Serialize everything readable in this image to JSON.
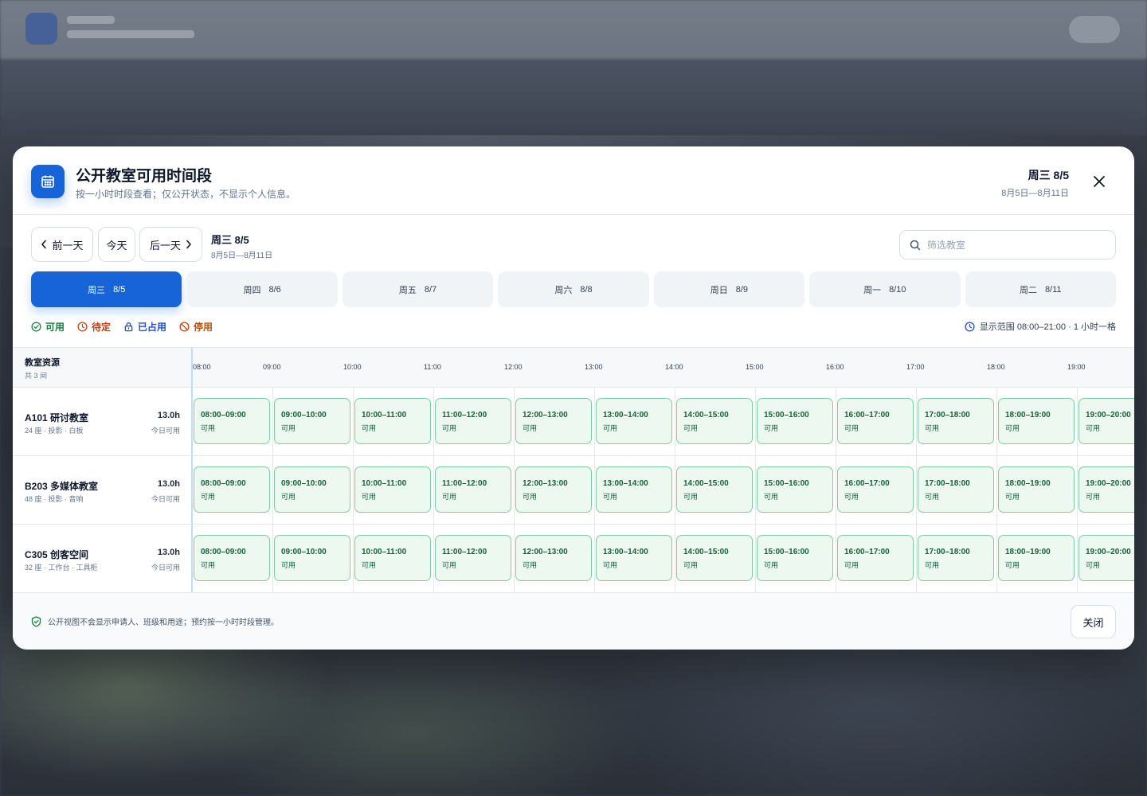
{
  "modal": {
    "title": "公开教室可用时间段",
    "subtitle": "按一小时时段查看；仅公开状态，不显示个人信息。",
    "current_day": "周三 8/5",
    "date_range": "8月5日—8月11日"
  },
  "toolbar": {
    "prev_label": "前一天",
    "today_label": "今天",
    "next_label": "后一天",
    "current_day": "周三 8/5",
    "date_range": "8月5日—8月11日",
    "search_placeholder": "筛选教室",
    "search_value": ""
  },
  "day_tabs": [
    {
      "weekday": "周三",
      "date": "8/5",
      "active": true
    },
    {
      "weekday": "周四",
      "date": "8/6",
      "active": false
    },
    {
      "weekday": "周五",
      "date": "8/7",
      "active": false
    },
    {
      "weekday": "周六",
      "date": "8/8",
      "active": false
    },
    {
      "weekday": "周日",
      "date": "8/9",
      "active": false
    },
    {
      "weekday": "周一",
      "date": "8/10",
      "active": false
    },
    {
      "weekday": "周二",
      "date": "8/11",
      "active": false
    }
  ],
  "legend": {
    "available": "可用",
    "pending": "待定",
    "occupied": "已占用",
    "disabled": "停用",
    "range_note": "显示范围 08:00–21:00 · 1 小时一格"
  },
  "grid": {
    "resource_header": "教室资源",
    "resource_count": "共 3 间",
    "hours": [
      "08:00",
      "09:00",
      "10:00",
      "11:00",
      "12:00",
      "13:00",
      "14:00",
      "15:00",
      "16:00",
      "17:00",
      "18:00",
      "19:00"
    ],
    "rooms": [
      {
        "name": "A101 研讨教室",
        "meta": "24 座 · 投影 · 白板",
        "hours": "13.0h",
        "hours_label": "今日可用",
        "slots": [
          {
            "time": "08:00–09:00",
            "status": "可用"
          },
          {
            "time": "09:00–10:00",
            "status": "可用"
          },
          {
            "time": "10:00–11:00",
            "status": "可用"
          },
          {
            "time": "11:00–12:00",
            "status": "可用"
          },
          {
            "time": "12:00–13:00",
            "status": "可用"
          },
          {
            "time": "13:00–14:00",
            "status": "可用"
          },
          {
            "time": "14:00–15:00",
            "status": "可用"
          },
          {
            "time": "15:00–16:00",
            "status": "可用"
          },
          {
            "time": "16:00–17:00",
            "status": "可用"
          },
          {
            "time": "17:00–18:00",
            "status": "可用"
          },
          {
            "time": "18:00–19:00",
            "status": "可用"
          },
          {
            "time": "19:00–20:00",
            "status": "可用"
          }
        ]
      },
      {
        "name": "B203 多媒体教室",
        "meta": "48 座 · 投影 · 音响",
        "hours": "13.0h",
        "hours_label": "今日可用",
        "slots": [
          {
            "time": "08:00–09:00",
            "status": "可用"
          },
          {
            "time": "09:00–10:00",
            "status": "可用"
          },
          {
            "time": "10:00–11:00",
            "status": "可用"
          },
          {
            "time": "11:00–12:00",
            "status": "可用"
          },
          {
            "time": "12:00–13:00",
            "status": "可用"
          },
          {
            "time": "13:00–14:00",
            "status": "可用"
          },
          {
            "time": "14:00–15:00",
            "status": "可用"
          },
          {
            "time": "15:00–16:00",
            "status": "可用"
          },
          {
            "time": "16:00–17:00",
            "status": "可用"
          },
          {
            "time": "17:00–18:00",
            "status": "可用"
          },
          {
            "time": "18:00–19:00",
            "status": "可用"
          },
          {
            "time": "19:00–20:00",
            "status": "可用"
          }
        ]
      },
      {
        "name": "C305 创客空间",
        "meta": "32 座 · 工作台 · 工具柜",
        "hours": "13.0h",
        "hours_label": "今日可用",
        "slots": [
          {
            "time": "08:00–09:00",
            "status": "可用"
          },
          {
            "time": "09:00–10:00",
            "status": "可用"
          },
          {
            "time": "10:00–11:00",
            "status": "可用"
          },
          {
            "time": "11:00–12:00",
            "status": "可用"
          },
          {
            "time": "12:00–13:00",
            "status": "可用"
          },
          {
            "time": "13:00–14:00",
            "status": "可用"
          },
          {
            "time": "14:00–15:00",
            "status": "可用"
          },
          {
            "time": "15:00–16:00",
            "status": "可用"
          },
          {
            "time": "16:00–17:00",
            "status": "可用"
          },
          {
            "time": "17:00–18:00",
            "status": "可用"
          },
          {
            "time": "18:00–19:00",
            "status": "可用"
          },
          {
            "time": "19:00–20:00",
            "status": "可用"
          }
        ]
      }
    ]
  },
  "footer": {
    "note": "公开视图不会显示申请人、班级和用途；预约按一小时时段管理。",
    "close_label": "关闭"
  },
  "colors": {
    "accent": "#1764d8",
    "available_bg": "#ecf8f0",
    "available_border": "#7ccf9d",
    "available_text": "#15623a"
  }
}
